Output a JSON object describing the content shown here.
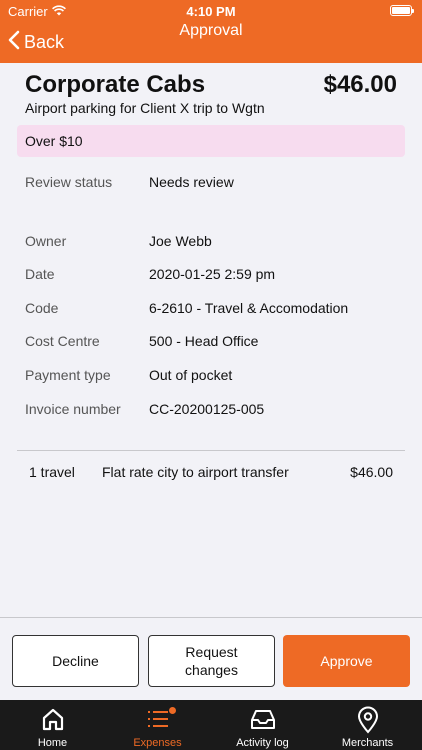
{
  "status_bar": {
    "carrier": "Carrier",
    "time": "4:10 PM"
  },
  "nav": {
    "back_label": "Back",
    "title": "Approval"
  },
  "expense": {
    "merchant": "Corporate Cabs",
    "amount": "$46.00",
    "description": "Airport parking for Client X trip to Wgtn",
    "banner": "Over $10"
  },
  "fields": [
    {
      "label": "Review status",
      "value": "Needs review"
    },
    {
      "label": "Owner",
      "value": "Joe Webb"
    },
    {
      "label": "Date",
      "value": "2020-01-25 2:59 pm"
    },
    {
      "label": "Code",
      "value": "6-2610 - Travel & Accomodation"
    },
    {
      "label": "Cost Centre",
      "value": "500 - Head Office"
    },
    {
      "label": "Payment type",
      "value": "Out of pocket"
    },
    {
      "label": "Invoice number",
      "value": "CC-20200125-005"
    }
  ],
  "line_items": [
    {
      "qty": "1 travel",
      "description": "Flat rate city to airport transfer",
      "amount": "$46.00"
    }
  ],
  "actions": {
    "decline": "Decline",
    "request_line1": "Request",
    "request_line2": "changes",
    "approve": "Approve"
  },
  "tabbar": {
    "tabs": [
      {
        "label": "Home",
        "icon": "home-icon"
      },
      {
        "label": "Expenses",
        "icon": "list-icon",
        "active": true,
        "badge": true
      },
      {
        "label": "Activity log",
        "icon": "inbox-icon"
      },
      {
        "label": "Merchants",
        "icon": "location-pin-icon"
      }
    ]
  },
  "colors": {
    "accent": "#ee6a25",
    "banner_bg": "#f7dcef",
    "tabbar_bg": "#1a1a1a"
  }
}
